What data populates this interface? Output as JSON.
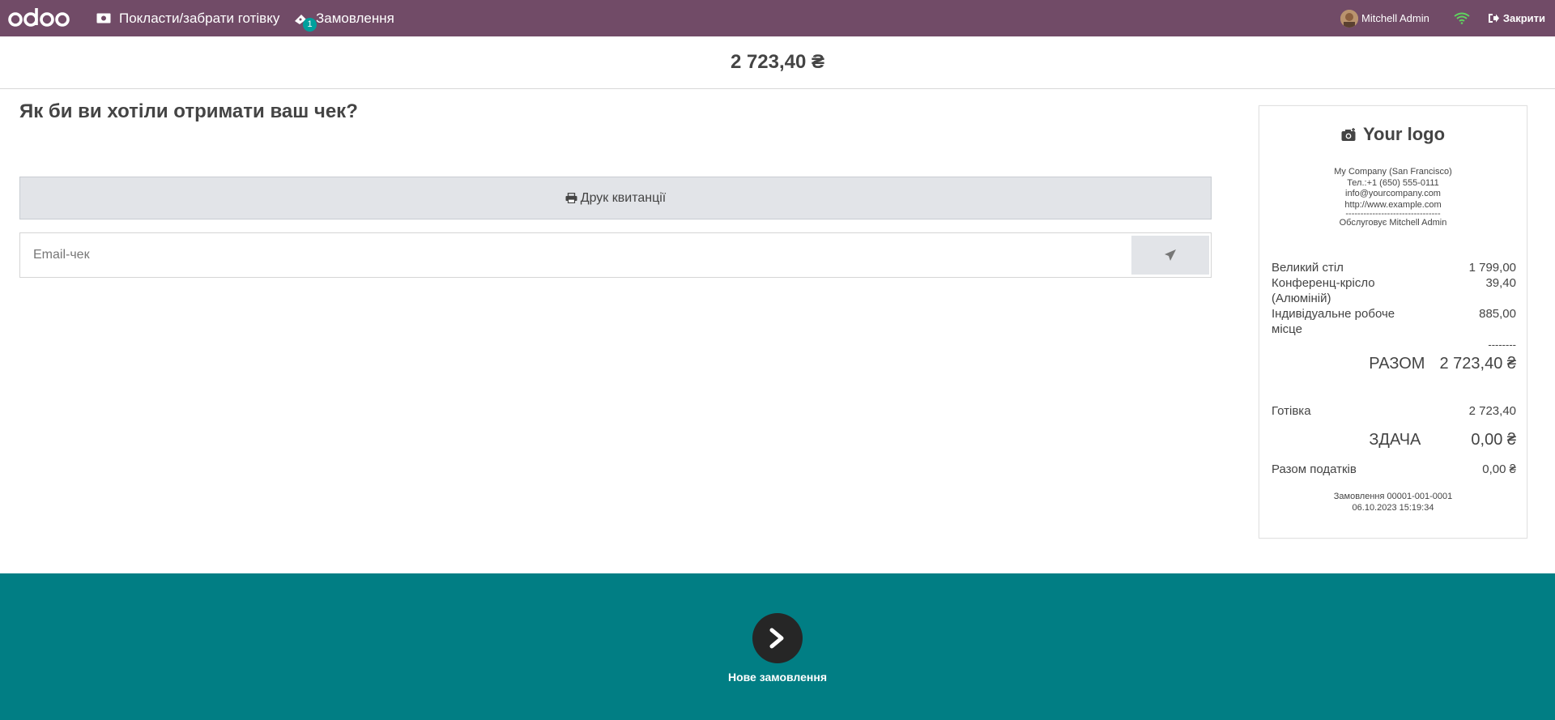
{
  "topbar": {
    "logo_text": "odoo",
    "cash_label": "Покласти/забрати готівку",
    "orders_label": "Замовлення",
    "orders_badge": "1",
    "user_name": "Mitchell Admin",
    "close_label": "Закрити",
    "bg_color": "#714b67"
  },
  "amount": "2 723,40 ₴",
  "question": "Як би ви хотіли отримати ваш чек?",
  "print_label": "Друк квитанції",
  "email": {
    "placeholder": "Email-чек",
    "value": ""
  },
  "receipt": {
    "logo_text": "Your logo",
    "company_lines": [
      "My Company (San Francisco)",
      "Тел.:+1 (650) 555-0111",
      "info@yourcompany.com",
      "http://www.example.com",
      "--------------------------------",
      "Обслуговує Mitchell Admin"
    ],
    "items": [
      {
        "name": "Великий стіл",
        "price": "1 799,00"
      },
      {
        "name": "Конференц-крісло (Алюміній)",
        "price": "39,40"
      },
      {
        "name": "Індивідуальне робоче місце",
        "price": "885,00"
      }
    ],
    "separator": "--------",
    "total_label": "РАЗОМ",
    "total_value": "2 723,40 ₴",
    "payment_label": "Готівка",
    "payment_value": "2 723,40",
    "change_label": "ЗДАЧА",
    "change_value": "0,00 ₴",
    "tax_label": "Разом податків",
    "tax_value": "0,00 ₴",
    "order_ref": "Замовлення 00001-001-0001",
    "order_date": "06.10.2023 15:19:34"
  },
  "bottom": {
    "next_label": "Нове замовлення",
    "bg_color": "#017e84"
  }
}
